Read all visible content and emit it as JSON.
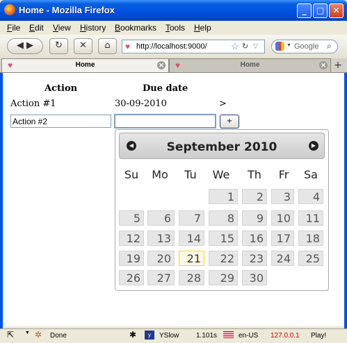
{
  "window": {
    "title": "Home - Mozilla Firefox",
    "buttons": {
      "minimize": "_",
      "maximize": "□",
      "close": "✕"
    }
  },
  "menu": [
    "File",
    "Edit",
    "View",
    "History",
    "Bookmarks",
    "Tools",
    "Help"
  ],
  "toolbar": {
    "back": "◀ ▶",
    "reload": "↻",
    "stop": "✕",
    "home": "⌂",
    "url": "http://localhost:9000/",
    "search_placeholder": "Google"
  },
  "tabs": [
    {
      "label": "Home",
      "active": true
    },
    {
      "label": "Home",
      "active": false
    }
  ],
  "newtab": "+",
  "page": {
    "headers": {
      "action": "Action",
      "due": "Due date"
    },
    "row": {
      "action": "Action #1",
      "due": "30-09-2010",
      "extra": ">"
    },
    "form": {
      "name_value": "Action #2",
      "date_value": "",
      "add_label": "+"
    }
  },
  "datepicker": {
    "title": "September 2010",
    "prev": "◀",
    "next": "▶",
    "weekdays": [
      "Su",
      "Mo",
      "Tu",
      "We",
      "Th",
      "Fr",
      "Sa"
    ],
    "days": [
      "1",
      "2",
      "3",
      "4",
      "5",
      "6",
      "7",
      "8",
      "9",
      "10",
      "11",
      "12",
      "13",
      "14",
      "15",
      "16",
      "17",
      "18",
      "19",
      "20",
      "21",
      "22",
      "23",
      "24",
      "25",
      "26",
      "27",
      "28",
      "29",
      "30"
    ],
    "first_weekday_index": 3,
    "today": "21"
  },
  "status": {
    "text": "Done",
    "yslow": "YSlow",
    "time": "1.101s",
    "locale": "en-US",
    "ip": "127.0.0.1",
    "play": "Play!"
  },
  "colors": {
    "ip": "#c00000",
    "accent": "#0054e3"
  }
}
